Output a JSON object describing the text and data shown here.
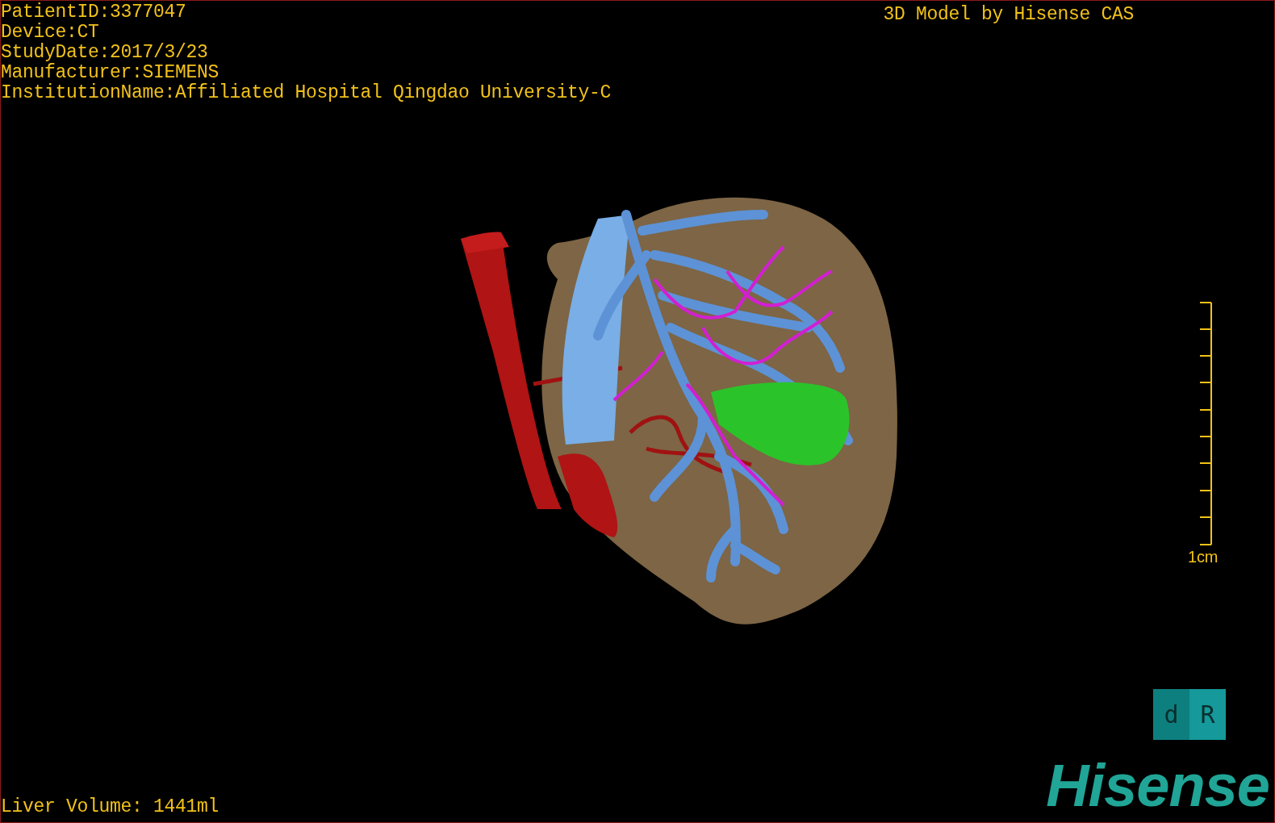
{
  "study_info": [
    "PatientID:3377047",
    "Device:CT",
    "StudyDate:2017/3/23",
    "Manufacturer:SIEMENS",
    "InstitutionName:Affiliated Hospital Qingdao University-C"
  ],
  "title": "3D Model by Hisense CAS",
  "scale_bar": {
    "label": "1cm"
  },
  "orientation_cube": {
    "faces": [
      {
        "label": "d"
      },
      {
        "label": "R"
      }
    ]
  },
  "liver_volume": "Liver Volume: 1441ml",
  "logo": "Hisense"
}
